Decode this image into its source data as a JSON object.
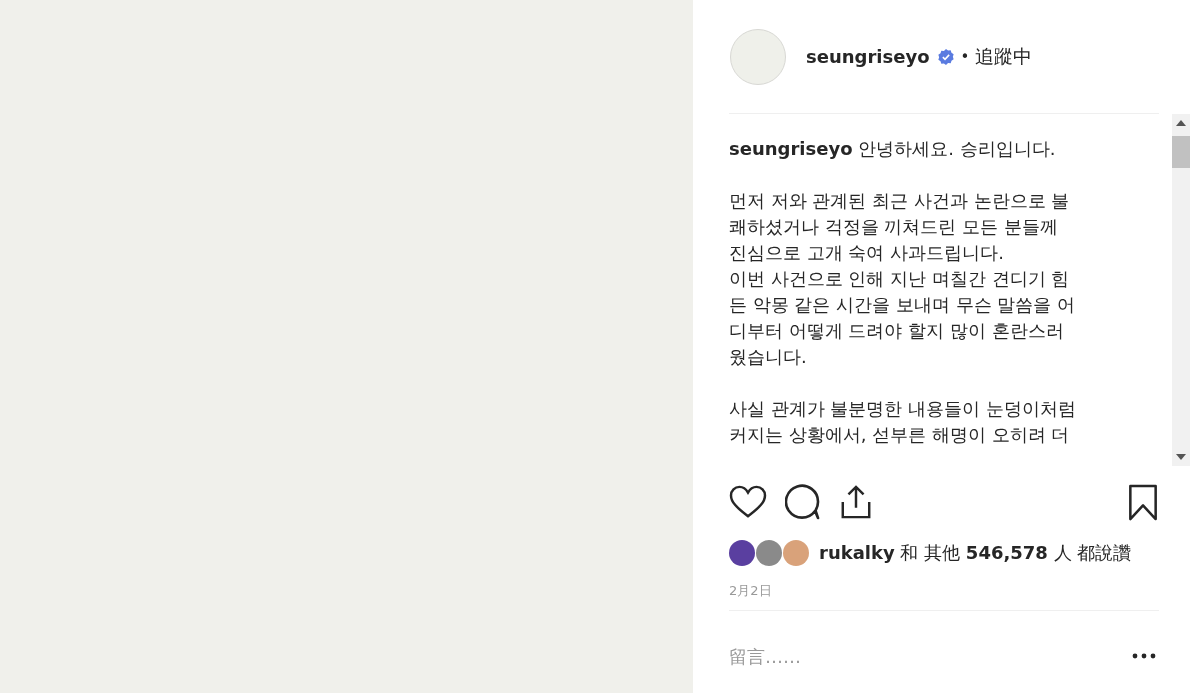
{
  "header": {
    "username": "seungriseyo",
    "verified": true,
    "separator": "•",
    "follow_label": "追蹤中"
  },
  "caption": {
    "username": "seungriseyo",
    "paragraphs": [
      [
        "안녕하세요. 승리입니다."
      ],
      [
        "먼저 저와 관계된 최근 사건과 논란으로 불",
        "쾌하셨거나 걱정을 끼쳐드린 모든 분들께",
        "진심으로 고개 숙여 사과드립니다.",
        "이번 사건으로 인해 지난 며칠간 견디기 힘",
        "든 악몽 같은 시간을 보내며 무슨 말씀을 어",
        "디부터 어떻게 드려야 할지 많이 혼란스러",
        "웠습니다."
      ],
      [
        "사실 관계가 불분명한 내용들이 눈덩이처럼",
        "커지는 상황에서, 섣부른 해명이 오히려 더"
      ]
    ]
  },
  "actions": {
    "liked": false,
    "saved": false
  },
  "likes": {
    "avatars": [
      {
        "color": "#5a3fa0"
      },
      {
        "color": "#8a8a8a"
      },
      {
        "color": "#d9a27a"
      }
    ],
    "text": "**rukalky** 和 其他 **546,578** 人 都說讚"
  },
  "date": "2月2日",
  "comment": {
    "placeholder": "留言……"
  }
}
